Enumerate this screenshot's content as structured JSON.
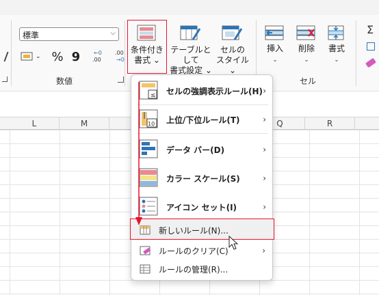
{
  "number_group": {
    "format_value": "標準",
    "percent": "%",
    "comma": "9",
    "inc_decimal": "←0\n.00",
    "dec_decimal": ".00\n→0",
    "label": "数値"
  },
  "styles_group": {
    "conditional_formatting": [
      "条件付き",
      "書式 ⌄"
    ],
    "format_as_table": [
      "テーブルとして",
      "書式設定 ⌄"
    ],
    "cell_styles": [
      "セルの",
      "スタイル ⌄"
    ]
  },
  "cells_group": {
    "insert": "挿入",
    "delete": "削除",
    "format": "書式",
    "label": "セル"
  },
  "columns": [
    "L",
    "M",
    "Q",
    "R"
  ],
  "menu": {
    "items": [
      {
        "label": "セルの強調表示ルール(H)",
        "has_submenu": true
      },
      {
        "label": "上位/下位ルール(T)",
        "has_submenu": true
      },
      {
        "label": "データ バー(D)",
        "has_submenu": true
      },
      {
        "label": "カラー スケール(S)",
        "has_submenu": true
      },
      {
        "label": "アイコン セット(I)",
        "has_submenu": true
      },
      {
        "label": "新しいルール(N)...",
        "has_submenu": false
      },
      {
        "label": "ルールのクリア(C)",
        "has_submenu": true
      },
      {
        "label": "ルールの管理(R)...",
        "has_submenu": false
      }
    ],
    "icon_10": "10"
  },
  "colors": {
    "highlight": "#e8132b",
    "accent_blue": "#2e74b5"
  }
}
